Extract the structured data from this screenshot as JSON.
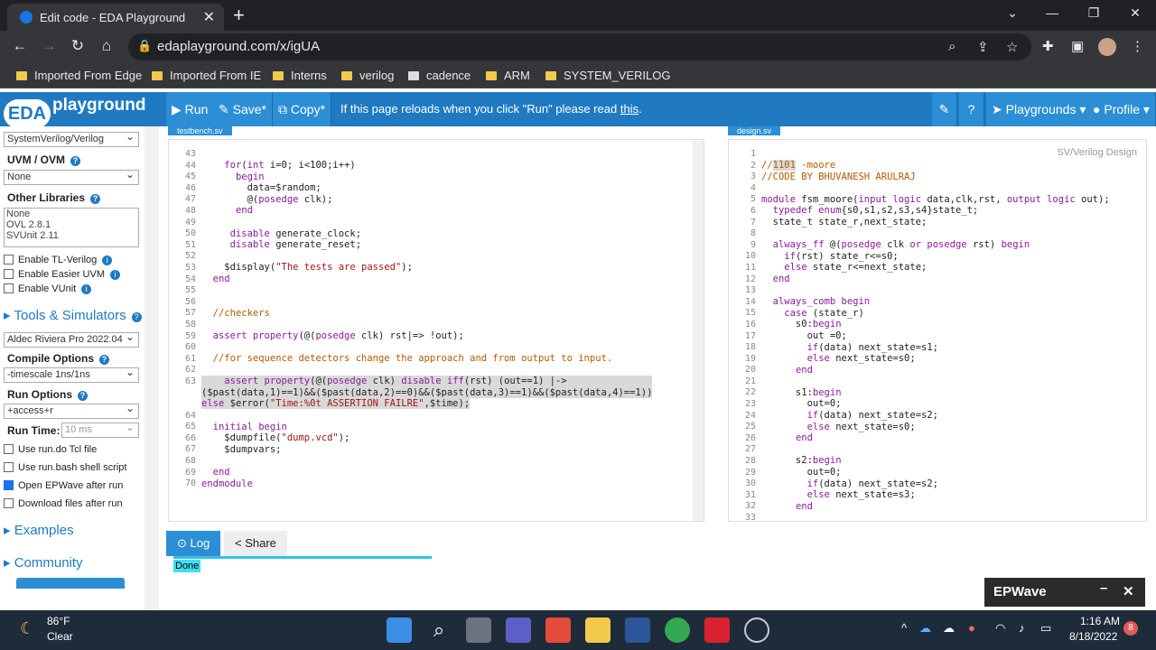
{
  "browser": {
    "tab_title": "Edit code - EDA Playground",
    "url": "edaplayground.com/x/igUA",
    "bookmarks": [
      "Imported From Edge",
      "Imported From IE",
      "Interns",
      "verilog",
      "cadence",
      "ARM",
      "SYSTEM_VERILOG"
    ]
  },
  "eda": {
    "logo_text": "EDA",
    "logo_sub": "playground",
    "run_label": "Run",
    "save_label": "Save*",
    "copy_label": "Copy*",
    "notice_text": "If this page reloads when you click \"Run\" please read",
    "notice_link": "this",
    "playgrounds_label": "Playgrounds",
    "profile_label": "Profile"
  },
  "sidebar": {
    "language_value": "SystemVerilog/Verilog",
    "uvm_label": "UVM / OVM",
    "uvm_value": "None",
    "other_libs_label": "Other Libraries",
    "other_libs": [
      "None",
      "OVL 2.8.1",
      "SVUnit 2.11"
    ],
    "enable_tl": "Enable TL-Verilog",
    "enable_uvm": "Enable Easier UVM",
    "enable_vunit": "Enable VUnit",
    "tools_label": "Tools & Simulators",
    "tool_value": "Aldec Riviera Pro 2022.04",
    "compile_label": "Compile Options",
    "compile_value": "-timescale 1ns/1ns",
    "run_options_label": "Run Options",
    "run_options_value": "+access+r",
    "run_time_label": "Run Time:",
    "run_time_placeholder": "10 ms",
    "use_run_do": "Use run.do Tcl file",
    "use_run_bash": "Use run.bash shell script",
    "open_epwave": "Open EPWave after run",
    "download_files": "Download files after run",
    "examples_label": "Examples",
    "community_label": "Community"
  },
  "editor_left": {
    "tab": "testbench.sv",
    "line_numbers": [
      "43",
      "44",
      "45",
      "46",
      "47",
      "48",
      "49",
      "50",
      "51",
      "52",
      "53",
      "54",
      "55",
      "56",
      "57",
      "58",
      "59",
      "60",
      "61",
      "62",
      "63",
      "",
      "",
      "64",
      "65",
      "66",
      "67",
      "68",
      "69",
      "70"
    ]
  },
  "editor_right": {
    "tab": "design.sv",
    "hint": "SV/Verilog Design",
    "line_numbers": [
      "1",
      "2",
      "3",
      "4",
      "5",
      "6",
      "7",
      "8",
      "9",
      "10",
      "11",
      "12",
      "13",
      "14",
      "15",
      "16",
      "17",
      "18",
      "19",
      "20",
      "21",
      "22",
      "23",
      "24",
      "25",
      "26",
      "27",
      "28",
      "29",
      "30",
      "31",
      "32",
      "33"
    ]
  },
  "log": {
    "log_tab": "Log",
    "share_tab": "Share",
    "status": "Done"
  },
  "epwave": {
    "title": "EPWave"
  },
  "taskbar": {
    "temp": "86°F",
    "weather": "Clear",
    "time": "1:16 AM",
    "date": "8/18/2022",
    "badge": "8"
  }
}
